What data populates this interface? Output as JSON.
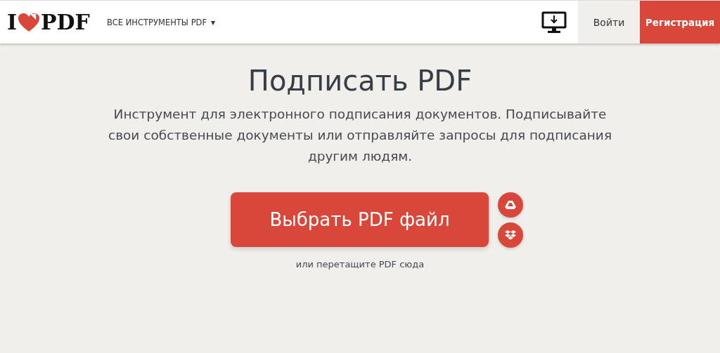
{
  "header": {
    "logo": {
      "left": "I",
      "right": "PDF"
    },
    "tools_menu": {
      "label": "ВСЕ ИНСТРУМЕНТЫ PDF",
      "caret": "▾"
    },
    "login": "Войти",
    "register": "Регистрация"
  },
  "hero": {
    "title": "Подписать PDF",
    "description": "Инструмент для электронного подписания документов. Подписывайте свои собственные документы или отправляйте запросы для подписания другим людям.",
    "select_button": "Выбрать PDF файл",
    "drop_hint": "или перетащите PDF сюда"
  }
}
